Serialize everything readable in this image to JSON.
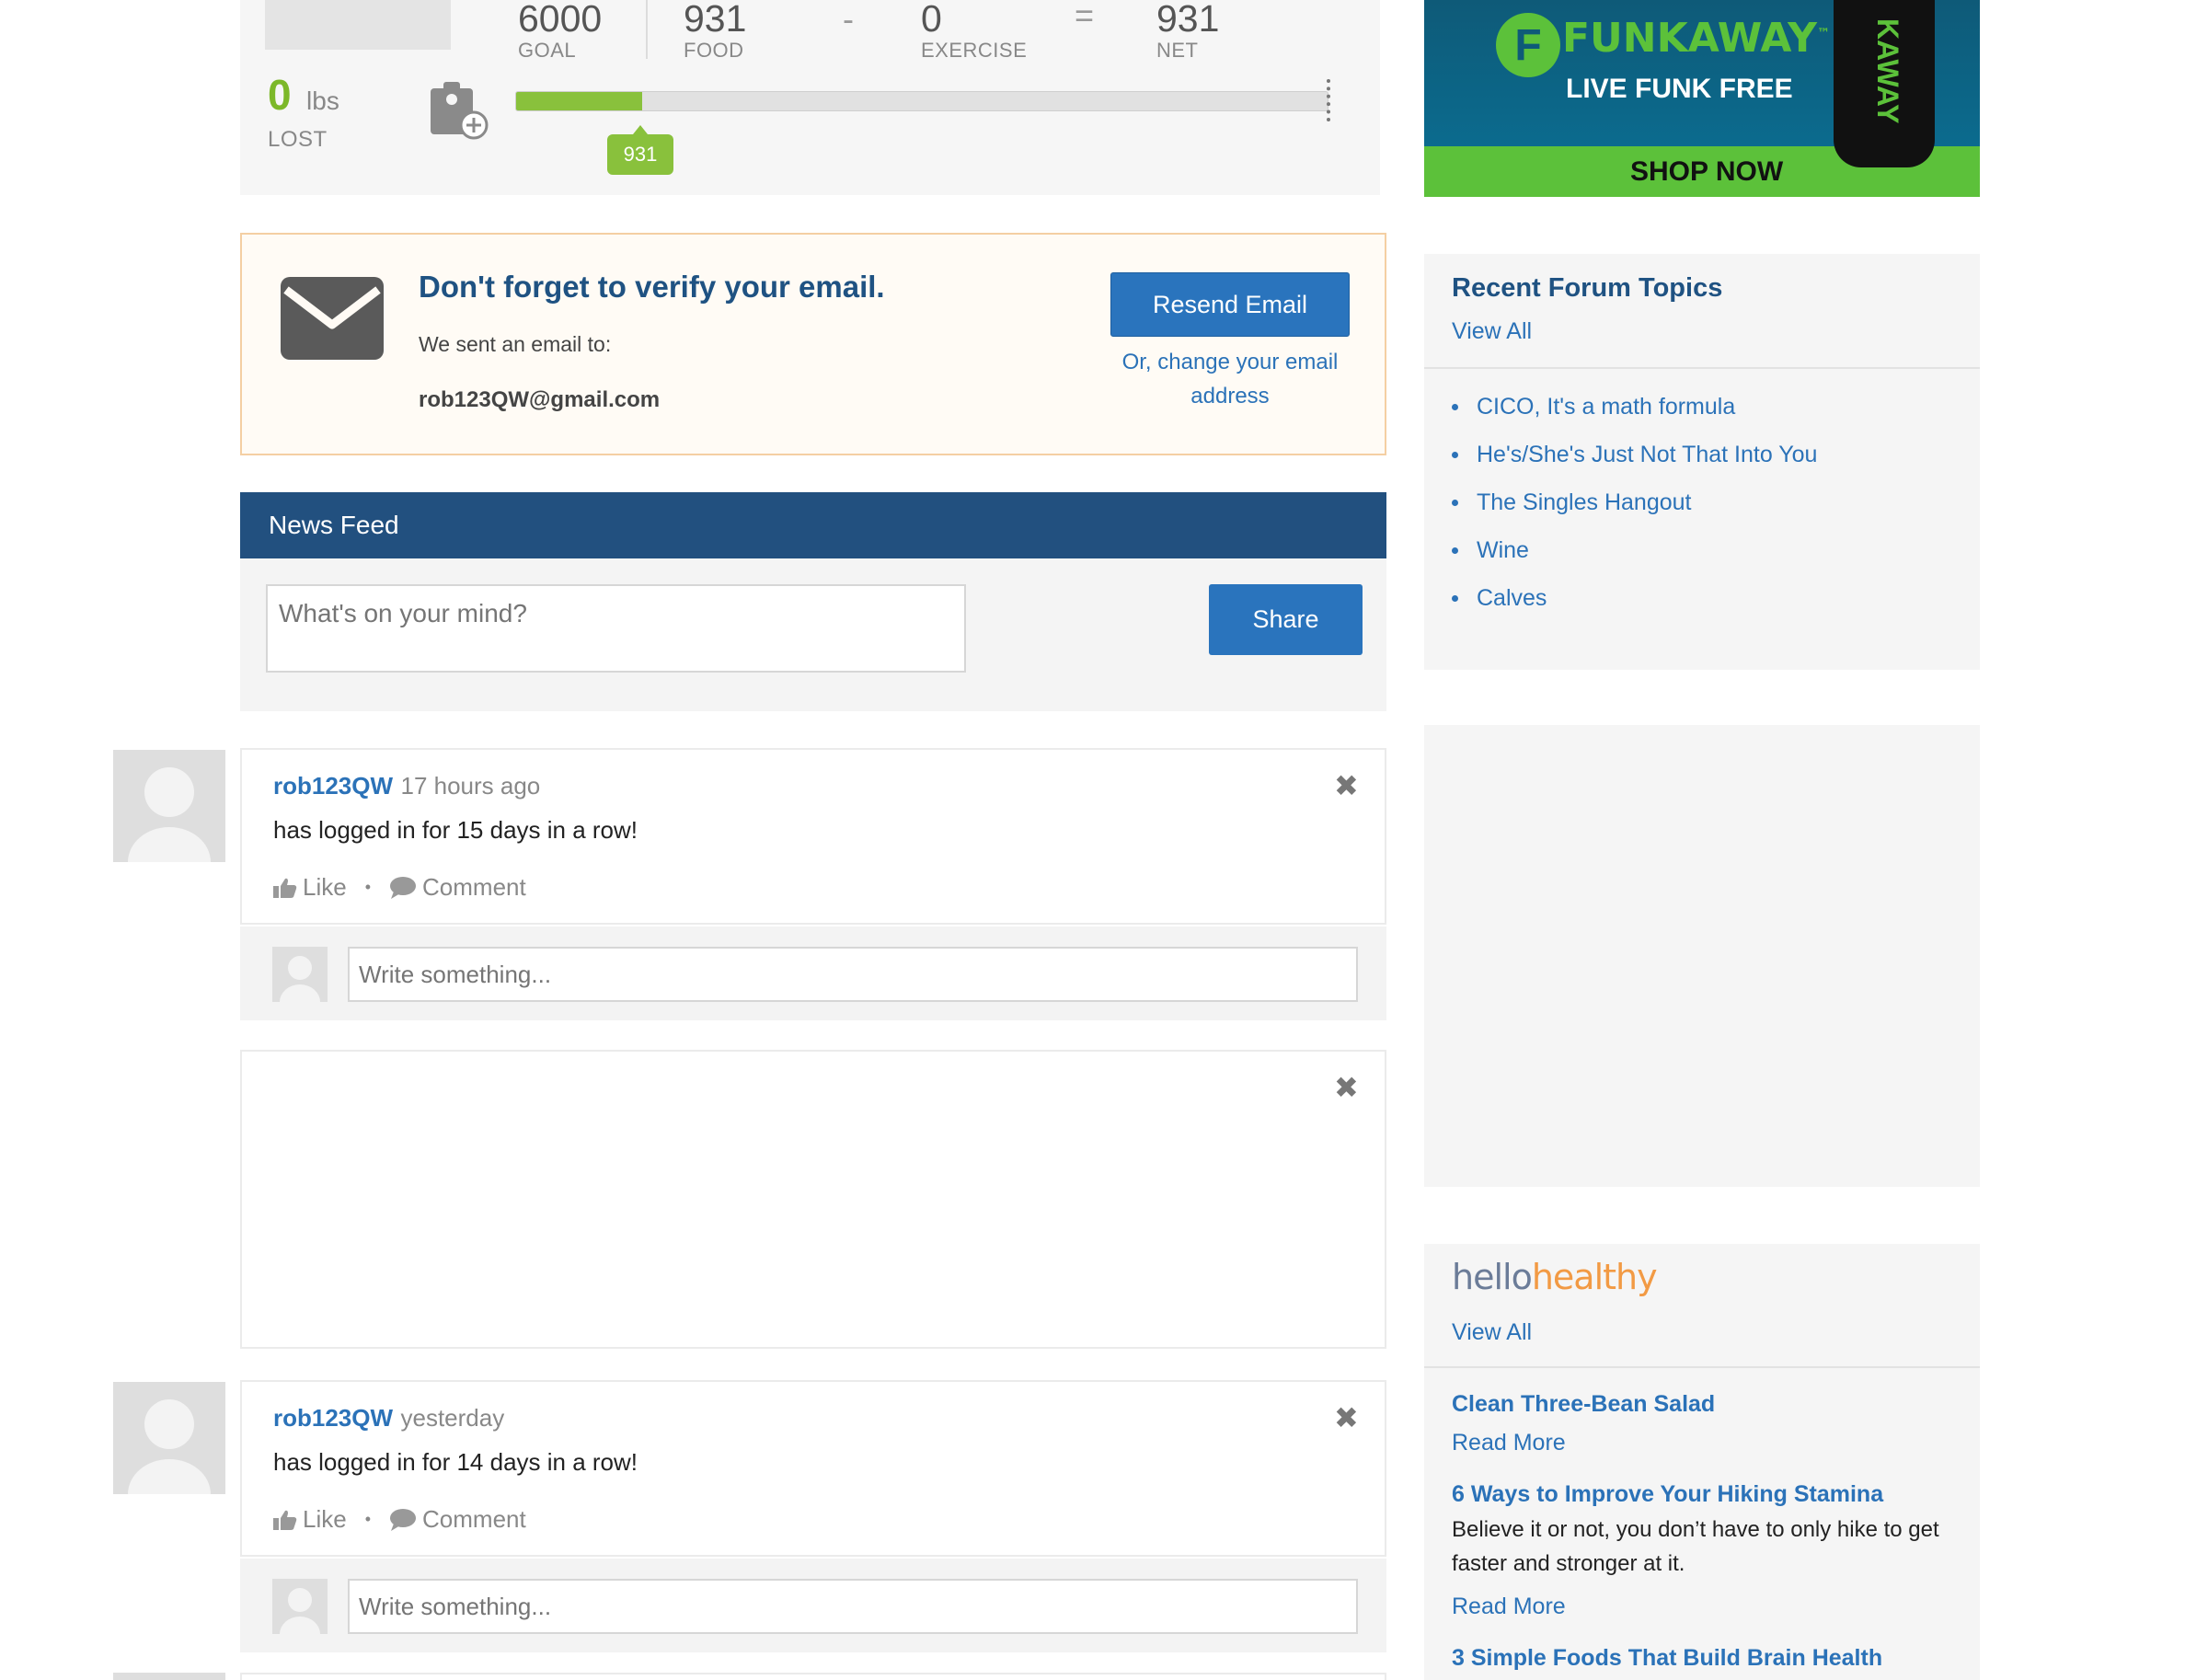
{
  "summary": {
    "goal_value": "6000",
    "goal_label": "GOAL",
    "food_value": "931",
    "food_label": "FOOD",
    "minus_sign": "-",
    "exercise_value": "0",
    "exercise_label": "EXERCISE",
    "equals_sign": "=",
    "net_value": "931",
    "net_label": "NET",
    "lost_value": "0",
    "lost_unit": "lbs",
    "lost_label": "LOST",
    "progress_tip": "931",
    "progress_fraction": 0.155,
    "progress_color": "#89c13c"
  },
  "ad_banner": {
    "logo_letter": "F",
    "brand": "FUNKAWAY",
    "trademark": "™",
    "tagline": "LIVE FUNK FREE",
    "cta": "SHOP NOW",
    "can_text": "KAWAY"
  },
  "verify": {
    "title": "Don't forget to verify your email.",
    "sent_label": "We sent an email to:",
    "email": "rob123QW@gmail.com",
    "resend_button": "Resend Email",
    "change_link": "Or, change your email address"
  },
  "feed": {
    "header": "News Feed",
    "status_placeholder": "What's on your mind?",
    "share_button": "Share",
    "like_label": "Like",
    "comment_label": "Comment",
    "comment_placeholder": "Write something...",
    "separator": "•",
    "entries": [
      {
        "user": "rob123QW",
        "time": "17 hours ago",
        "text": "has logged in for 15 days in a row!"
      },
      {
        "user": "rob123QW",
        "time": "yesterday",
        "text": "has logged in for 14 days in a row!"
      }
    ]
  },
  "sidebar": {
    "forum": {
      "title": "Recent Forum Topics",
      "view_all": "View All",
      "items": [
        "CICO, It's a math formula",
        "He's/She's Just Not That Into You",
        "The Singles Hangout",
        "Wine",
        "Calves"
      ]
    },
    "hellohealthy": {
      "logo_part1": "hello",
      "logo_part2": "healthy",
      "view_all": "View All",
      "articles": [
        {
          "title": "Clean Three-Bean Salad",
          "read_more": "Read More"
        },
        {
          "title": "6 Ways to Improve Your Hiking Stamina",
          "body": "Believe it or not, you don’t have to only hike to get faster and stronger at it.",
          "read_more": "Read More"
        },
        {
          "title": "3 Simple Foods That Build Brain Health"
        }
      ]
    }
  },
  "colors": {
    "brand_blue": "#22507f",
    "link_blue": "#2b72b8",
    "button_blue": "#2a74bd",
    "accent_green": "#7cb829"
  }
}
